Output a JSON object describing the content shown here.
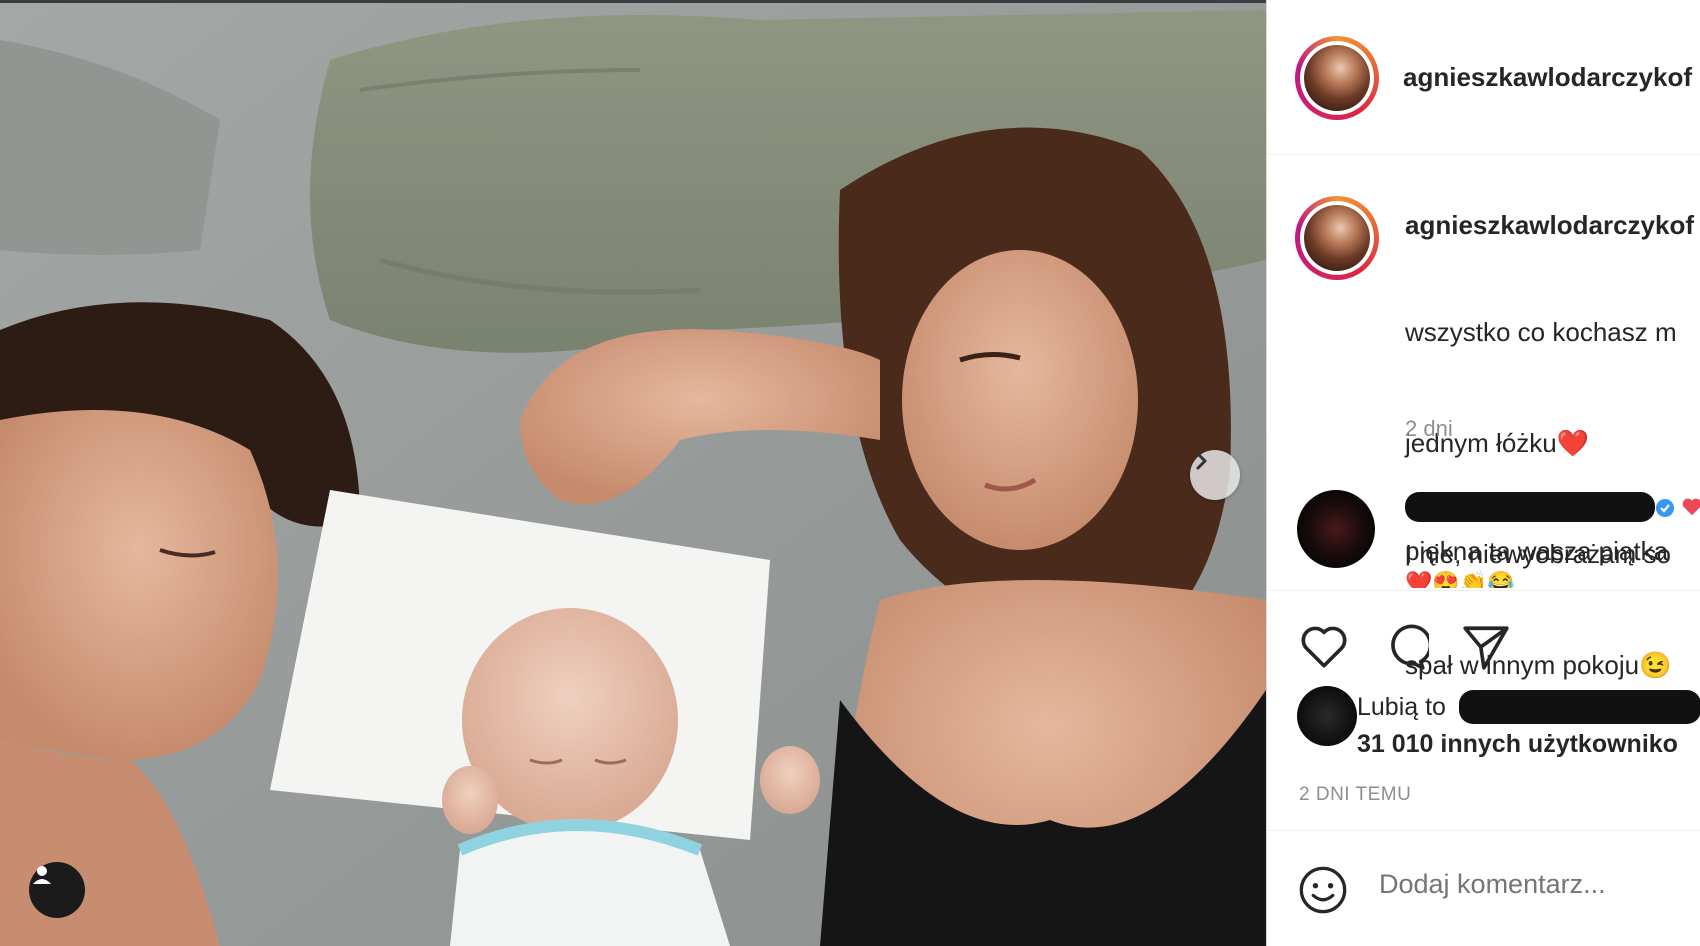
{
  "post": {
    "username": "agnieszkawlodarczykof",
    "caption_lines": [
      "wszystko co kochasz m",
      "jednym łóżku❤️",
      "I nie, niewyobrażam so",
      "spał w innym pokoju😉"
    ],
    "caption_time": "2 dni",
    "comment_text": "piękna ta wasza piątka",
    "comment_emojis": "❤️😍👏😂",
    "likes_prefix": "Lubią to",
    "likes_count": "31 010 innych użytkowniko",
    "date": "2 DNI TEMU",
    "comment_placeholder": "Dodaj komentarz..."
  },
  "icons": {
    "next": "chevron-right-icon",
    "tag": "user-tag-icon",
    "like": "heart-icon",
    "comment": "comment-icon",
    "share": "share-icon",
    "emoji": "emoji-icon"
  },
  "colors": {
    "text": "#262626",
    "muted": "#8e8e8e",
    "border": "#dbdbdb",
    "heart": "#ed4956"
  }
}
